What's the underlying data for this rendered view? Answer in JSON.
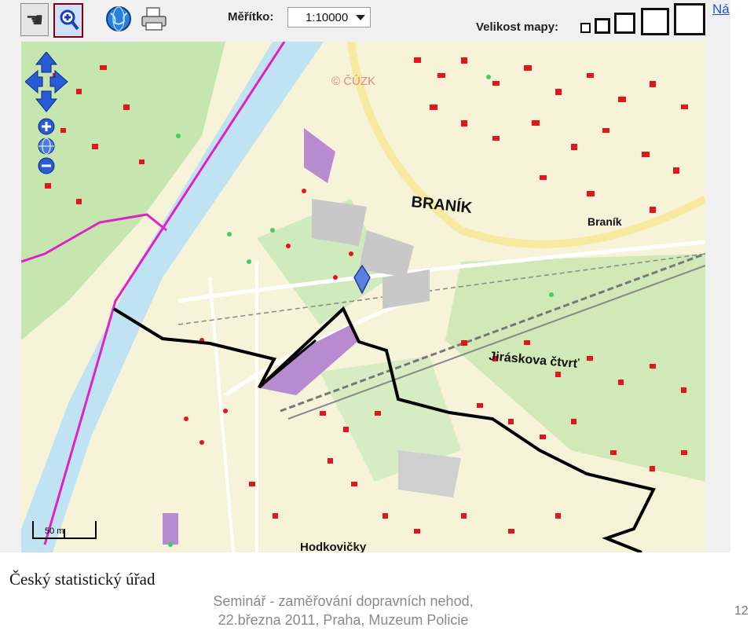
{
  "toolbar": {
    "scale_label": "Měřítko:",
    "scale_value": "1:10000",
    "mapsize_label": "Velikost mapy:",
    "link_label": "Ná"
  },
  "map": {
    "watermark": "© ČÚZK",
    "labels": {
      "branik_big": "BRANÍK",
      "branik_station": "Braník",
      "jiraskova": "Jiráskova čtvrť",
      "hodkovicky": "Hodkovičky",
      "scale_bar": "50 m"
    }
  },
  "slide": {
    "footer_left": "Český statistický úřad",
    "footer_line1": "Seminář - zaměřování dopravních nehod,",
    "footer_line2": "22.března 2011, Praha, Muzeum Policie",
    "page_number": "12"
  },
  "colors": {
    "buildings": "#e8141c",
    "route": "#000000",
    "boundary": "#e020c8",
    "river": "#bfe3f2",
    "forest": "#b9e0a0",
    "nav_blue": "#2a5bd7"
  }
}
